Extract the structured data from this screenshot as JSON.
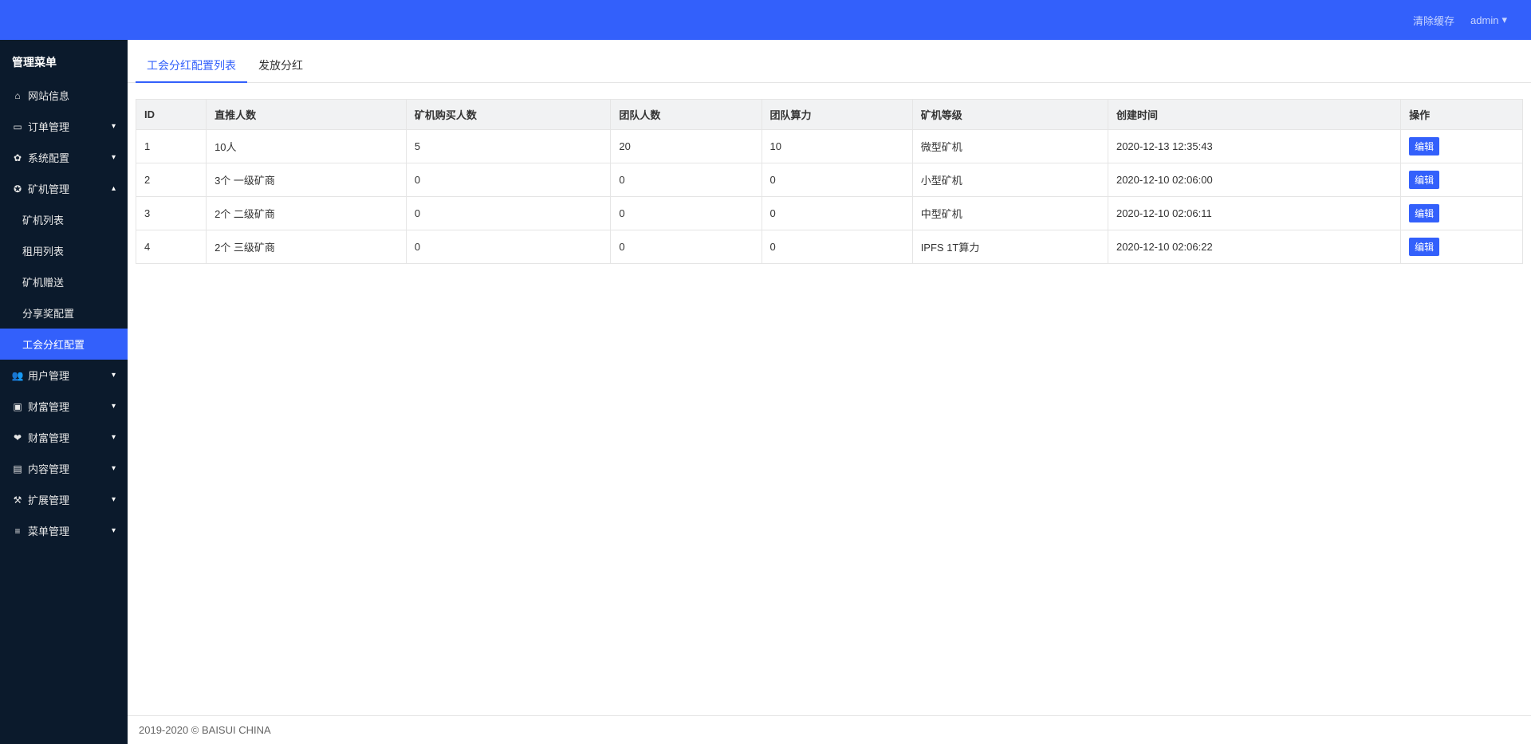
{
  "topbar": {
    "clear_cache": "清除缓存",
    "user": "admin"
  },
  "sidebar": {
    "title": "管理菜单",
    "items": [
      {
        "icon": "home",
        "label": "网站信息",
        "expandable": false
      },
      {
        "icon": "card",
        "label": "订单管理",
        "expandable": true
      },
      {
        "icon": "gears",
        "label": "系统配置",
        "expandable": true
      },
      {
        "icon": "rebel",
        "label": "矿机管理",
        "expandable": true,
        "expanded": true,
        "submenu": [
          {
            "label": "矿机列表"
          },
          {
            "label": "租用列表"
          },
          {
            "label": "矿机赠送"
          },
          {
            "label": "分享奖配置"
          },
          {
            "label": "工会分红配置",
            "active": true
          }
        ]
      },
      {
        "icon": "users",
        "label": "用户管理",
        "expandable": true
      },
      {
        "icon": "money",
        "label": "财富管理",
        "expandable": true
      },
      {
        "icon": "heart",
        "label": "财富管理",
        "expandable": true
      },
      {
        "icon": "file",
        "label": "内容管理",
        "expandable": true
      },
      {
        "icon": "wrench",
        "label": "扩展管理",
        "expandable": true
      },
      {
        "icon": "list",
        "label": "菜单管理",
        "expandable": true
      }
    ]
  },
  "tabs": [
    {
      "label": "工会分红配置列表",
      "active": true
    },
    {
      "label": "发放分红"
    }
  ],
  "table": {
    "columns": [
      "ID",
      "直推人数",
      "矿机购买人数",
      "团队人数",
      "团队算力",
      "矿机等级",
      "创建时间",
      "操作"
    ],
    "edit_label": "编辑",
    "rows": [
      {
        "id": "1",
        "direct": "10人",
        "buyers": "5",
        "team": "20",
        "power": "10",
        "level": "微型矿机",
        "created": "2020-12-13 12:35:43"
      },
      {
        "id": "2",
        "direct": "3个 一级矿商",
        "buyers": "0",
        "team": "0",
        "power": "0",
        "level": "小型矿机",
        "created": "2020-12-10 02:06:00"
      },
      {
        "id": "3",
        "direct": "2个 二级矿商",
        "buyers": "0",
        "team": "0",
        "power": "0",
        "level": "中型矿机",
        "created": "2020-12-10 02:06:11"
      },
      {
        "id": "4",
        "direct": "2个 三级矿商",
        "buyers": "0",
        "team": "0",
        "power": "0",
        "level": "IPFS 1T算力",
        "created": "2020-12-10 02:06:22"
      }
    ]
  },
  "footer": "2019-2020 © BAISUI CHINA",
  "icons": {
    "home": "⌂",
    "card": "▭",
    "gears": "✿",
    "rebel": "✪",
    "users": "👥",
    "money": "▣",
    "heart": "❤",
    "file": "▤",
    "wrench": "⚒",
    "list": "≡"
  }
}
